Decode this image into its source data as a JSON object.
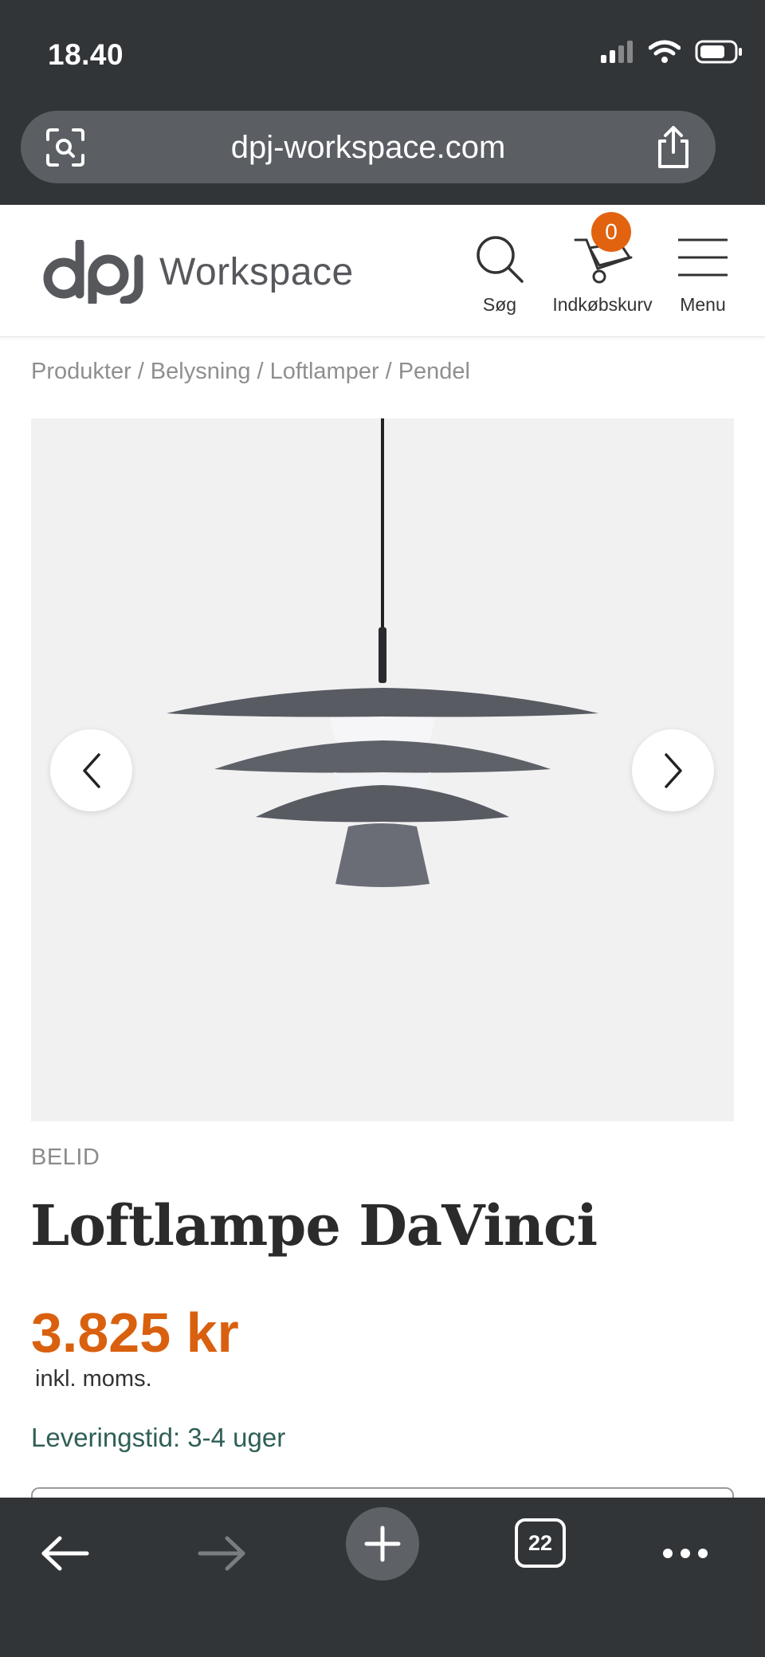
{
  "status_bar": {
    "time": "18.40"
  },
  "browser": {
    "url": "dpj-workspace.com",
    "tab_count": "22"
  },
  "header": {
    "logo_mark": "dpj",
    "logo_word": "Workspace",
    "search_label": "Søg",
    "cart_label": "Indkøbskurv",
    "cart_count": "0",
    "menu_label": "Menu"
  },
  "breadcrumb": [
    "Produkter",
    "Belysning",
    "Loftlamper",
    "Pendel"
  ],
  "product": {
    "brand": "BELID",
    "title": "Loftlampe DaVinci",
    "price": "3.825 kr",
    "vat_note": "inkl. moms.",
    "delivery": "Leveringstid: 3-4 uger"
  },
  "colors": {
    "chrome": "#323538",
    "accent": "#e2630f",
    "delivery_text": "#2f5f57"
  },
  "icons": [
    "camera-search-icon",
    "share-icon",
    "search-icon",
    "cart-icon",
    "hamburger-icon",
    "chevron-left-icon",
    "chevron-right-icon",
    "back-icon",
    "forward-icon",
    "plus-icon",
    "tabs-icon",
    "more-icon"
  ]
}
